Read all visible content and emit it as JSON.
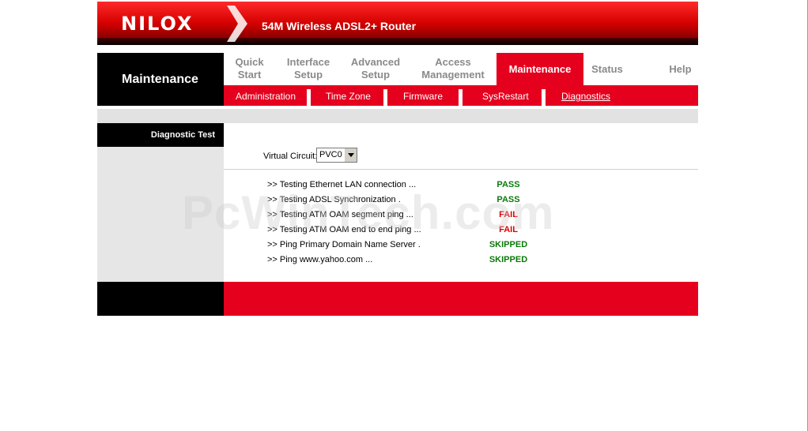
{
  "header": {
    "logo": "NILOX",
    "router_title": "54M Wireless ADSL2+ Router"
  },
  "nav": {
    "section": "Maintenance",
    "tabs": [
      {
        "line1": "Quick",
        "line2": "Start"
      },
      {
        "line1": "Interface",
        "line2": "Setup"
      },
      {
        "line1": "Advanced",
        "line2": "Setup"
      },
      {
        "line1": "Access",
        "line2": "Management"
      },
      {
        "label": "Maintenance"
      },
      {
        "label": "Status"
      },
      {
        "label": "Help"
      }
    ],
    "subtabs": [
      "Administration",
      "Time Zone",
      "Firmware",
      "SysRestart",
      "Diagnostics"
    ]
  },
  "left": {
    "label": "Diagnostic Test"
  },
  "form": {
    "vc_label": "Virtual Circuit:",
    "vc_value": "PVC0"
  },
  "tests": [
    {
      "name": ">> Testing Ethernet LAN connection ...",
      "result": "PASS"
    },
    {
      "name": ">> Testing ADSL Synchronization .",
      "result": "PASS"
    },
    {
      "name": ">> Testing ATM OAM segment ping ...",
      "result": "FAIL"
    },
    {
      "name": ">> Testing ATM OAM end to end ping ...",
      "result": "FAIL"
    },
    {
      "name": ">> Ping Primary Domain Name Server .",
      "result": "SKIPPED"
    },
    {
      "name": ">> Ping www.yahoo.com ...",
      "result": "SKIPPED"
    }
  ],
  "watermark": "PcWinTech.com",
  "colors": {
    "brand_red": "#e5001e",
    "pass": "#0b7a0b",
    "fail": "#e00000"
  }
}
